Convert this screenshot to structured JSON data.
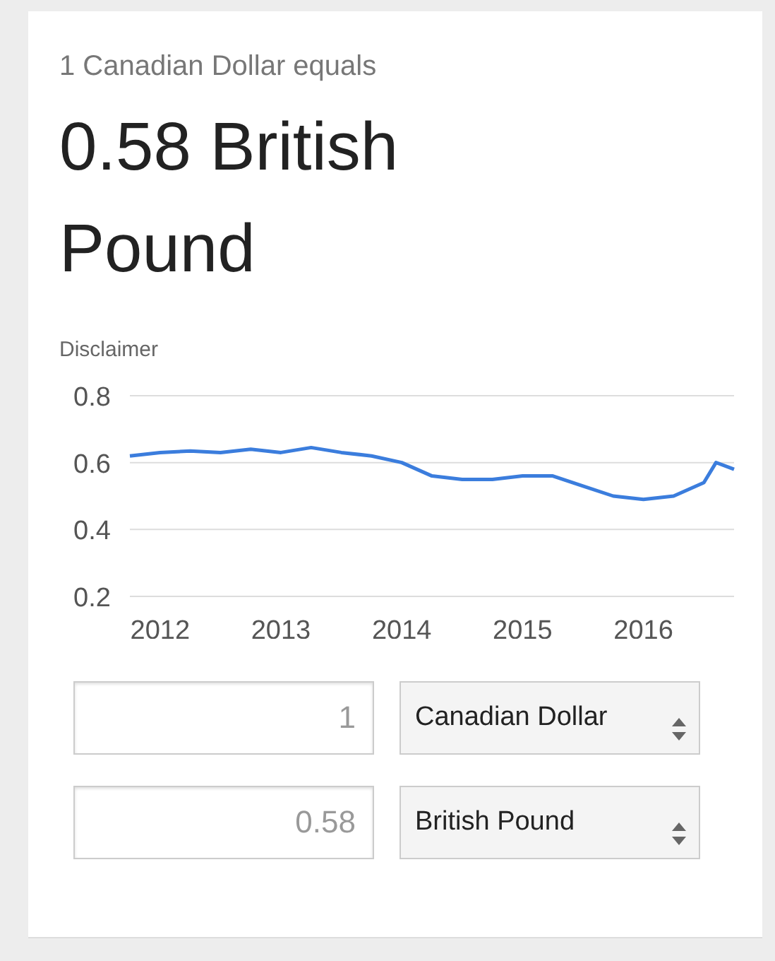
{
  "header": {
    "subtitle": "1 Canadian Dollar equals",
    "result": "0.58 British Pound",
    "disclaimer": "Disclaimer"
  },
  "chart": {
    "chart_data": {
      "type": "line",
      "x": [
        2011.75,
        2012,
        2012.25,
        2012.5,
        2012.75,
        2013,
        2013.25,
        2013.5,
        2013.75,
        2014,
        2014.25,
        2014.5,
        2014.75,
        2015,
        2015.25,
        2015.5,
        2015.75,
        2016,
        2016.25,
        2016.5,
        2016.6,
        2016.75
      ],
      "series": [
        {
          "color": "#3b7ddd",
          "values": [
            0.62,
            0.63,
            0.635,
            0.63,
            0.64,
            0.63,
            0.645,
            0.63,
            0.62,
            0.6,
            0.56,
            0.55,
            0.55,
            0.56,
            0.56,
            0.53,
            0.5,
            0.49,
            0.5,
            0.54,
            0.6,
            0.58
          ]
        }
      ],
      "xlim": [
        2011.75,
        2016.75
      ],
      "ylim": [
        0.2,
        0.8
      ],
      "xticks": [
        2012,
        2013,
        2014,
        2015,
        2016
      ],
      "yticks": [
        0.2,
        0.4,
        0.6,
        0.8
      ]
    }
  },
  "converter": [
    {
      "amount": "1",
      "currency": "Canadian Dollar"
    },
    {
      "amount": "0.58",
      "currency": "British Pound"
    }
  ]
}
